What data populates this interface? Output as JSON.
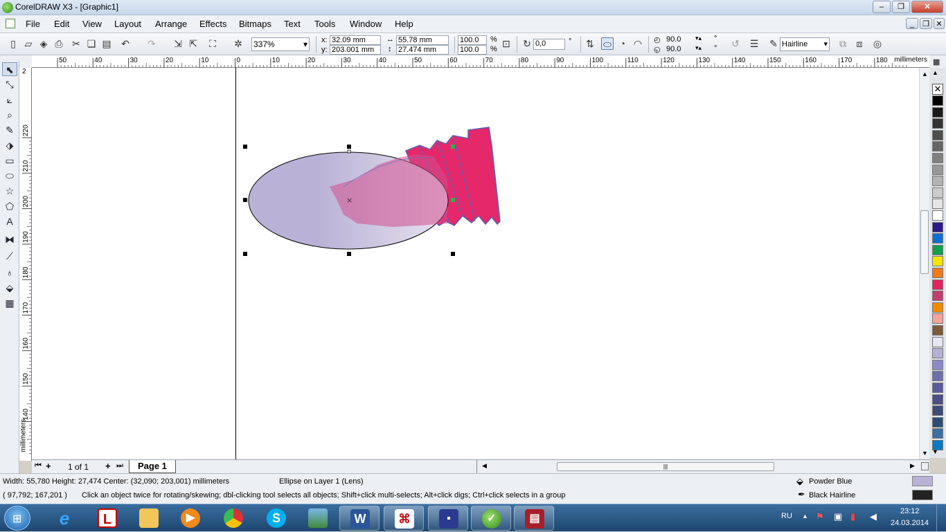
{
  "window": {
    "title": "CorelDRAW X3 - [Graphic1]",
    "minimize": "–",
    "restore": "❐",
    "close": "✕"
  },
  "menu": [
    "File",
    "Edit",
    "View",
    "Layout",
    "Arrange",
    "Effects",
    "Bitmaps",
    "Text",
    "Tools",
    "Window",
    "Help"
  ],
  "doc_controls": {
    "minimize": "_",
    "restore": "❐",
    "close": "✕"
  },
  "toolbar": {
    "zoom": "337%",
    "x_label": "x:",
    "x_value": "32.09 mm",
    "y_label": "y:",
    "y_value": "203.001 mm",
    "width_value": "55.78 mm",
    "height_value": "27.474 mm",
    "scale_x": "100.0",
    "scale_y": "100.0",
    "percent": "%",
    "rotation": "0,0",
    "degree": "°",
    "angle_start": "90.0",
    "angle_end": "90.0",
    "outline": "Hairline"
  },
  "ruler": {
    "unit": "millimeters",
    "h_ticks": [
      "50",
      "40",
      "30",
      "20",
      "10",
      "0",
      "10",
      "20",
      "30",
      "40",
      "50",
      "60",
      "70",
      "80",
      "90",
      "100",
      "110",
      "120",
      "130",
      "140",
      "150",
      "160",
      "170",
      "180"
    ],
    "v_ticks": [
      "220",
      "210",
      "200",
      "190",
      "180",
      "170",
      "160",
      "150",
      "140"
    ],
    "v_top": "2",
    "v_unit": "millimeters"
  },
  "pages": {
    "position": "1 of 1",
    "tab": "Page 1"
  },
  "status": {
    "dimensions": "Width: 55,780  Height: 27,474  Center: (32,090; 203,001)  millimeters",
    "object": "Ellipse on Layer 1  (Lens)",
    "coords": "( 97,792; 167,201 )",
    "hint": "Click an object twice for rotating/skewing; dbl-clicking tool selects all objects; Shift+click multi-selects; Alt+click digs; Ctrl+click selects in a group",
    "fill_name": "Powder Blue",
    "outline_name": "Black  Hairline"
  },
  "colors": {
    "fill_swatch": "#b9b2d6",
    "outline_swatch": "#222222",
    "palette": [
      "#000000",
      "#1a1a1a",
      "#333333",
      "#4d4d4d",
      "#666666",
      "#808080",
      "#999999",
      "#b3b3b3",
      "#cccccc",
      "#e6e6e6",
      "#ffffff",
      "#2e1a8a",
      "#0f6fd1",
      "#12a04a",
      "#f5e400",
      "#f07a1a",
      "#e1245d",
      "#c43c6e",
      "#f28a00",
      "#f6a39a",
      "#7a5b3a",
      "#e6e6f0",
      "#b3b1d6",
      "#8a8bc8",
      "#6f6fb0",
      "#5c5a9a",
      "#4b4e88",
      "#3c4b77",
      "#2c4d73",
      "#3a6ea5",
      "#0a78c2"
    ]
  },
  "tray": {
    "lang": "RU",
    "time": "23:12",
    "date": "24.03.2014"
  }
}
